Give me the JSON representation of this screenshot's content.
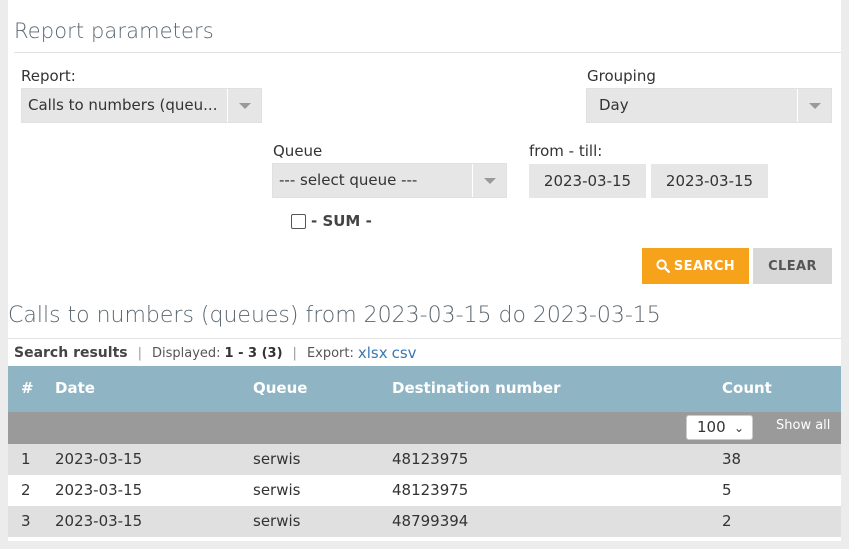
{
  "params": {
    "title": "Report parameters",
    "report_label": "Report:",
    "report_value": "Calls to numbers (queu...",
    "grouping_label": "Grouping",
    "grouping_value": "Day",
    "queue_label": "Queue",
    "queue_value": "--- select queue ---",
    "range_label": "from - till:",
    "from_date": "2023-03-15",
    "till_date": "2023-03-15",
    "sum_label": "- SUM -",
    "sum_checked": false,
    "search_label": "SEARCH",
    "clear_label": "CLEAR"
  },
  "results": {
    "title": "Calls to numbers (queues) from 2023-03-15 do 2023-03-15",
    "heading": "Search results",
    "displayed_label": "Displayed:",
    "displayed_value": "1 - 3 (3)",
    "export_label": "Export:",
    "export_xlsx": "xlsx",
    "export_csv": "csv",
    "columns": [
      "#",
      "Date",
      "Queue",
      "Destination number",
      "Count"
    ],
    "page_size": "100",
    "show_all": "Show all",
    "rows": [
      [
        "1",
        "2023-03-15",
        "serwis",
        "48123975",
        "38"
      ],
      [
        "2",
        "2023-03-15",
        "serwis",
        "48123975",
        "5"
      ],
      [
        "3",
        "2023-03-15",
        "serwis",
        "48799394",
        "2"
      ]
    ]
  },
  "colors": {
    "accent": "#f7a21b",
    "table_header": "#8fb4c4",
    "link": "#3b77b3"
  },
  "icons": {
    "search": "search-icon",
    "dropdown": "caret-down-icon"
  }
}
